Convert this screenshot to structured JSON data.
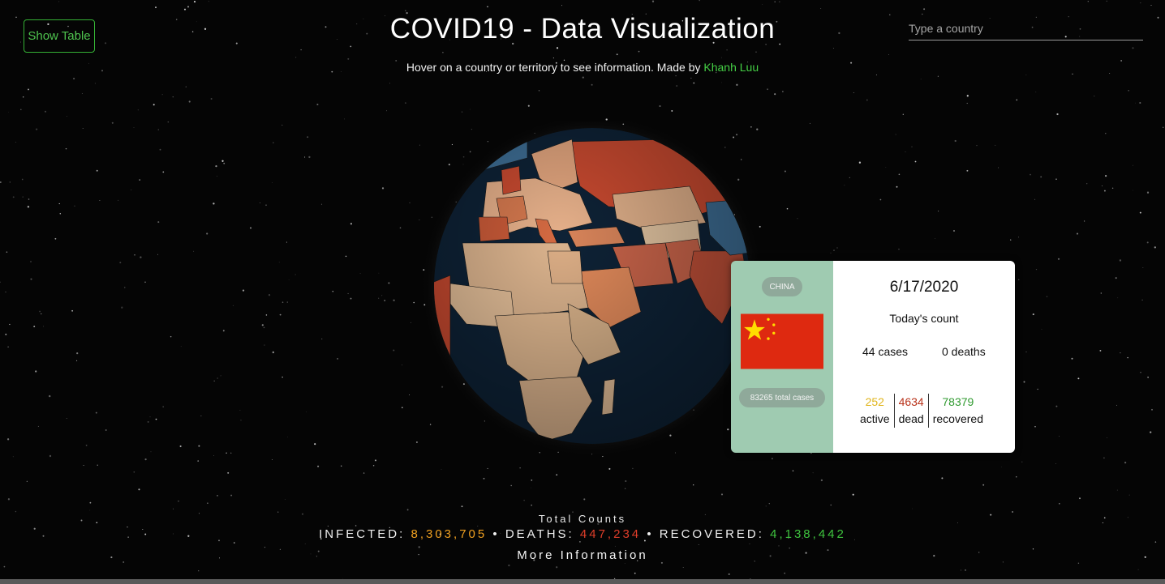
{
  "header": {
    "title": "COVID19 - Data Visualization",
    "subtitle_text": "Hover on a country or territory to see information. Made by",
    "author": "Khanh Luu",
    "show_table_label": "Show Table",
    "search_placeholder": "Type a country"
  },
  "tooltip": {
    "country": "CHINA",
    "total_cases": "83265 total cases",
    "date": "6/17/2020",
    "today_label": "Today's count",
    "daily_cases": "44 cases",
    "daily_deaths": "0 deaths",
    "stats": [
      {
        "value": "252",
        "label": "active",
        "color": "#e0b51b"
      },
      {
        "value": "4634",
        "label": "dead",
        "color": "#b8321a"
      },
      {
        "value": "78379",
        "label": "recovered",
        "color": "#2f9a2f"
      }
    ]
  },
  "totals": {
    "title": "Total Counts",
    "infected_label": "INFECTED:",
    "infected_value": "8,303,705",
    "deaths_label": "DEATHS:",
    "deaths_value": "447,234",
    "recovered_label": "RECOVERED:",
    "recovered_value": "4,138,442",
    "separator": "•",
    "more_info": "More Information"
  },
  "colors": {
    "accent": "#45d045",
    "ocean": "#0e2236",
    "land_light": "#dcb48e",
    "land_mid": "#e08a5c",
    "land_dark": "#c94a30",
    "card_panel": "#9fcbb1",
    "flag_red": "#de2910",
    "flag_star": "#ffde00"
  },
  "icons": {
    "flag": "china-flag-icon",
    "globe": "globe-map"
  }
}
